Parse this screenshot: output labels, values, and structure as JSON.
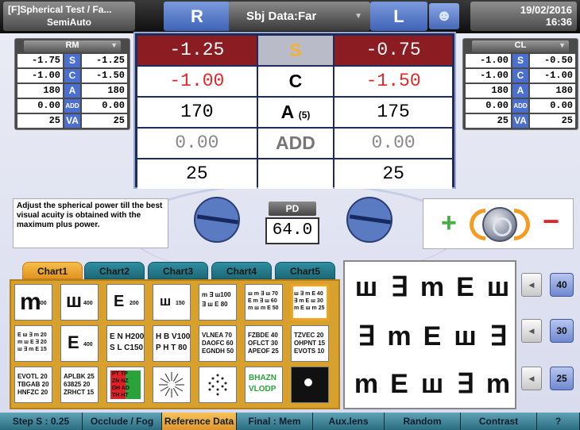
{
  "topbar": {
    "title_line1": "[F]Spherical Test / Fa...",
    "title_line2": "SemiAuto",
    "right_eye": "R",
    "subject_data": "Sbj Data:Far",
    "left_eye": "L",
    "user_icon": "user-icon",
    "date": "19/02/2016",
    "time": "16:36"
  },
  "rm": {
    "title": "RM",
    "rows": [
      {
        "left": "-1.75",
        "label": "S",
        "right": "-1.25"
      },
      {
        "left": "-1.00",
        "label": "C",
        "right": "-1.50"
      },
      {
        "left": "180",
        "label": "A",
        "right": "180"
      },
      {
        "left": "0.00",
        "label": "ADD",
        "right": "0.00"
      },
      {
        "left": "25",
        "label": "VA",
        "right": "25"
      }
    ]
  },
  "cl": {
    "title": "CL",
    "rows": [
      {
        "left": "-1.00",
        "label": "S",
        "right": "-0.50"
      },
      {
        "left": "-1.00",
        "label": "C",
        "right": "-1.00"
      },
      {
        "left": "180",
        "label": "A",
        "right": "180"
      },
      {
        "left": "0.00",
        "label": "ADD",
        "right": "0.00"
      },
      {
        "left": "25",
        "label": "VA",
        "right": "25"
      }
    ]
  },
  "center": {
    "s": {
      "r": "-1.25",
      "label": "S",
      "l": "-0.75"
    },
    "c": {
      "r": "-1.00",
      "label": "C",
      "l": "-1.50"
    },
    "a": {
      "r": "170",
      "label": "A",
      "sub": "(5)",
      "l": "175"
    },
    "add": {
      "r": "0.00",
      "label": "ADD",
      "l": "0.00"
    },
    "va": {
      "r": "25",
      "label": "",
      "l": "25"
    }
  },
  "message": "Adjust the spherical power till the best visual acuity is obtained with the maximum plus power.",
  "pd": {
    "label": "PD",
    "value": "64.0"
  },
  "knob": {
    "plus": "+",
    "minus": "−"
  },
  "tabs": [
    "Chart1",
    "Chart2",
    "Chart3",
    "Chart4",
    "Chart5"
  ],
  "chart_cells": {
    "r1": [
      {
        "big": "m",
        "num": "800"
      },
      {
        "big": "ш",
        "num": "400"
      },
      {
        "big": "E",
        "num": "200"
      },
      {
        "big": "ш",
        "num": "150"
      },
      {
        "lines": "m ∃ ш100\n∃ ш E 80"
      },
      {
        "lines": "ш m ∃ ш 70\nE m ∃ ш 60\nm ш m E 50"
      },
      {
        "lines": "ш ∃ m E 40\n∃ m E ш 30\nm E ш m 25"
      }
    ],
    "r2": [
      {
        "lines": "E ш ∃ m 20\nm ш E ∃ 20\nш ∃ m E 15"
      },
      {
        "big": "E",
        "num": "400"
      },
      {
        "lines": "E N H200\nS L C150"
      },
      {
        "lines": "H B V100\nP H T 80"
      },
      {
        "lines": "VLNEA 70\nDAOFC 60\nEGNDH 50"
      },
      {
        "lines": "FZBDE 40\nOFLCT 30\nAPEOF 25"
      },
      {
        "lines": "TZVEC 20\nOHPNT 15\nEVOTS 10"
      }
    ],
    "r3": [
      {
        "lines": "EVOTL 20\nTBGAB 20\nHNFZC 20"
      },
      {
        "lines": "APLBK 25\n63825 20\nZRHCT 15"
      },
      {
        "lines": "PT TP\nZN NZ\nDH AD\nTH HT"
      },
      {
        "lines": "clock"
      },
      {
        "lines": "dots"
      },
      {
        "lines": "BHAZN\nVLODP"
      },
      {
        "lines": "•"
      }
    ]
  },
  "optotype_rows": [
    {
      "chars": [
        "ш",
        "∃",
        "m",
        "E",
        "ш"
      ],
      "size": "40"
    },
    {
      "chars": [
        "∃",
        "m",
        "E",
        "ш",
        "∃"
      ],
      "size": "30"
    },
    {
      "chars": [
        "m",
        "E",
        "ш",
        "∃",
        "m"
      ],
      "size": "25"
    }
  ],
  "bottom": [
    "Step S : 0.25",
    "Occlude / Fog",
    "Reference Data",
    "Final : Mem",
    "Aux.lens",
    "Random",
    "Contrast",
    "?"
  ]
}
